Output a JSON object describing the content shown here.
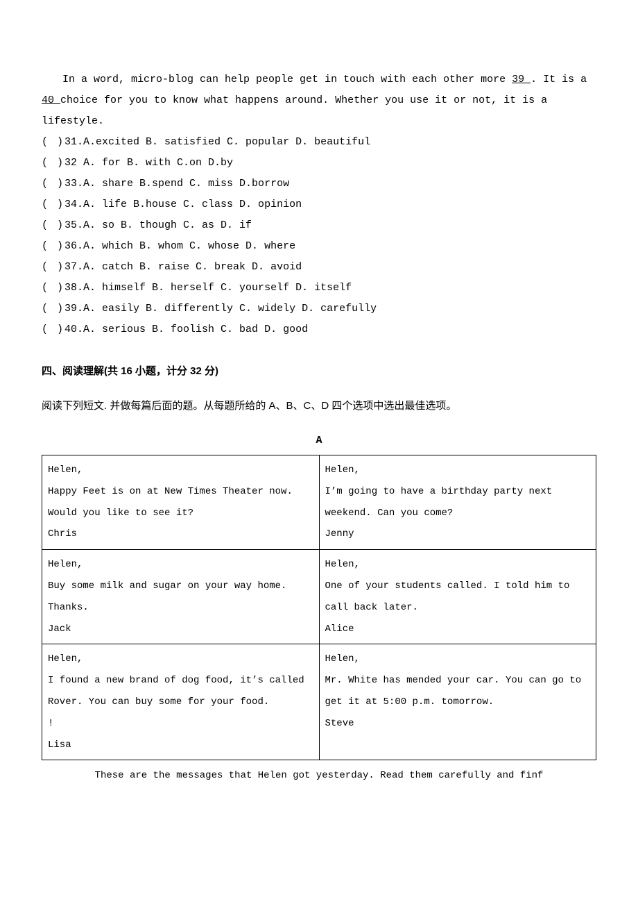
{
  "passage": {
    "text": "In a word, micro-blog can help people get in touch with each other more   39   . It is a   40   choice for you to know what happens around. Whether you use it or not, it is a lifestyle."
  },
  "options": [
    {
      "num": "31",
      "a": "A.excited",
      "b": "B. satisfied",
      "c": "C. popular",
      "d": "D. beautiful"
    },
    {
      "num": "32",
      "a": "A. for",
      "b": "B. with",
      "c": "C.on",
      "d": "D.by",
      "sep": " "
    },
    {
      "num": "33",
      "a": "A. share",
      "b": "B.spend",
      "c": "C. miss",
      "d": "D.borrow"
    },
    {
      "num": "34",
      "a": "A. life",
      "b": "B.house",
      "c": "C. class",
      "d": "D. opinion"
    },
    {
      "num": "35",
      "a": "A. so",
      "b": "B. though",
      "c": "C. as",
      "d": "D. if"
    },
    {
      "num": "36",
      "a": "A. which",
      "b": "B. whom",
      "c": "C. whose",
      "d": "D. where"
    },
    {
      "num": "37",
      "a": "A. catch",
      "b": "B. raise",
      "c": "C. break",
      "d": "D. avoid"
    },
    {
      "num": "38",
      "a": "A. himself",
      "b": "B. herself",
      "c": "C. yourself",
      "d": "D. itself"
    },
    {
      "num": "39",
      "a": "A. easily",
      "b": "B. differently",
      "c": "C. widely",
      "d": "D. carefully"
    },
    {
      "num": "40",
      "a": "A. serious",
      "b": "B. foolish",
      "c": "C. bad",
      "d": "D. good"
    }
  ],
  "section": {
    "title": "四、阅读理解(共 16 小题，计分 32 分)",
    "instruction": "阅读下列短文. 并做每篇后面的题。从每题所给的 A、B、C、D 四个选项中选出最佳选项。",
    "letter": "A"
  },
  "messages": {
    "r1c1": "Helen,\nHappy Feet is on at New Times Theater now. Would you like to see it?\nChris",
    "r1c2": "Helen,\nI’m going to have a birthday party next weekend. Can you come?\nJenny",
    "r2c1": "Helen,\nBuy some milk and sugar on your way home. Thanks.\nJack",
    "r2c2": "Helen,\nOne of your students called. I told him to call back later.\nAlice",
    "r3c1": "Helen,\nI found a new brand of dog food, it’s called Rover. You can buy some for your food.\n!\nLisa",
    "r3c2": "Helen,\nMr. White has mended your car. You can go to get it at 5:00 p.m. tomorrow.\nSteve"
  },
  "footnote": "These are the messages that Helen got yesterday. Read them carefully and finf"
}
